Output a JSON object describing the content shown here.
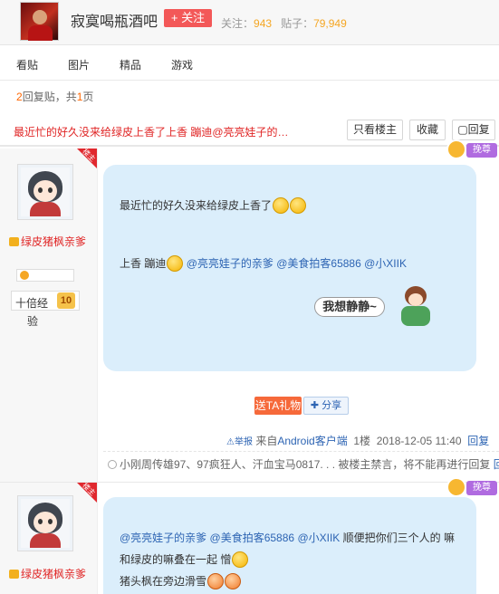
{
  "header": {
    "forum_name": "寂寞喝瓶酒吧",
    "follow_label": "+ 关注",
    "follow_count_label": "关注：",
    "follow_count": "943",
    "post_count_label": "贴子：",
    "post_count": "79,949"
  },
  "nav": {
    "items": [
      {
        "label": "看贴"
      },
      {
        "label": "图片"
      },
      {
        "label": "精品"
      },
      {
        "label": "游戏"
      }
    ]
  },
  "pagination": {
    "reply_count": "2",
    "reply_suffix": "回复贴，共",
    "page_count": "1",
    "page_suffix": "页"
  },
  "thread": {
    "title": "最近忙的好久没来给绿皮上香了上香  蹦迪@亮亮娃子的…",
    "only_op_label": "只看楼主",
    "favorite_label": "收藏",
    "reply_label": "回复"
  },
  "posts": [
    {
      "badge": "楼主",
      "username": "绿皮猪枫亲爹",
      "level_name": "十倍经",
      "level_name_2": "验",
      "level": "10",
      "decor_tag": "挽尊",
      "content": {
        "line1": "最近忙的好久没来给绿皮上香了",
        "line2_prefix": "上香 蹦迪",
        "mention1": "@亮亮娃子的亲爹",
        "mention2": "@美食拍客65886",
        "mention3": "@小XIIK",
        "mood_text": "我想静静~"
      },
      "gift_label": "送TA礼物",
      "share_label": "分享",
      "report_label": "举报",
      "client_prefix": "来自",
      "client": "Android客户端",
      "floor": "1楼",
      "time": "2018-12-05 11:40",
      "reply_label": "回复",
      "lzl_text": "小刚周传雄97、97疯狂人、汗血宝马0817. . . 被楼主禁言，将不能再进行回复"
    },
    {
      "badge": "楼主",
      "username": "绿皮猪枫亲爹",
      "decor_tag": "挽尊",
      "content": {
        "mention1": "@亮亮娃子的亲爹",
        "mention2": "@美食拍客65886",
        "mention3": "@小XIIK",
        "line1_suffix": "顺便把你们三个人的 嘛",
        "line2": "和绿皮的嘛叠在一起 憎",
        "line3": "猪头枫在旁边滑雪"
      }
    }
  ]
}
